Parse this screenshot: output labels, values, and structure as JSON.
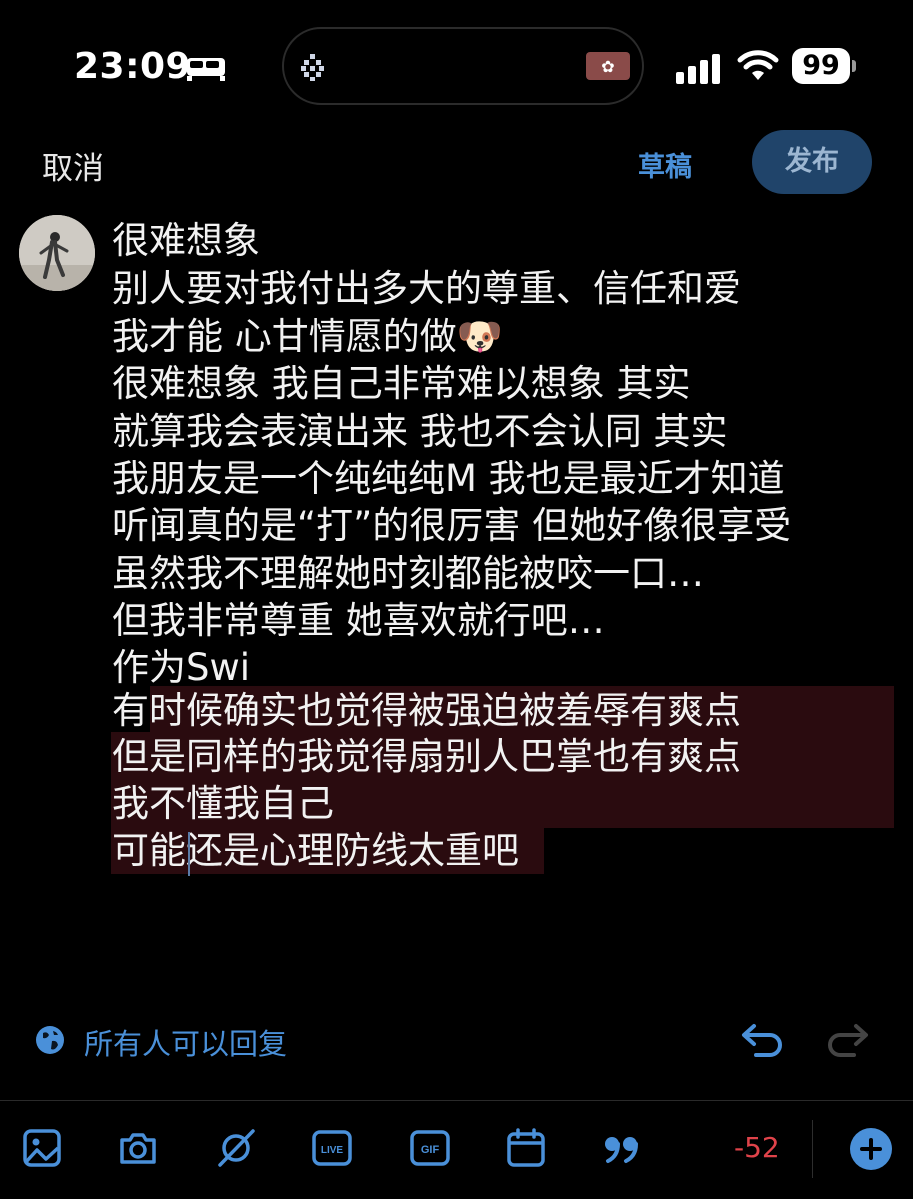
{
  "status_bar": {
    "time": "23:09",
    "battery": "99",
    "icons": [
      "bed-icon",
      "app-grid-icon",
      "flag-icon",
      "signal-icon",
      "wifi-icon",
      "battery-icon"
    ]
  },
  "nav": {
    "cancel": "取消",
    "drafts": "草稿",
    "publish": "发布"
  },
  "post": {
    "lines": [
      "很难想象",
      "别人要对我付出多大的尊重、信任和爱",
      "我才能 心甘情愿的做🐶",
      "很难想象 我自己非常难以想象 其实",
      "就算我会表演出来 我也不会认同 其实",
      "我朋友是一个纯纯纯M 我也是最近才知道",
      "听闻真的是“打”的很厉害 但她好像很享受",
      "虽然我不理解她时刻都能被咬一口…",
      "但我非常尊重 她喜欢就行吧…",
      "作为Swi",
      "有时候确实也觉得被强迫被羞辱有爽点",
      "但是同样的我觉得扇别人巴掌也有爽点",
      "我不懂我自己",
      "可能还是心理防线太重吧"
    ]
  },
  "reply_setting": {
    "label": "所有人可以回复"
  },
  "toolbar": {
    "icons": [
      "image-icon",
      "camera-icon",
      "no-location-icon",
      "live-icon",
      "gif-icon",
      "calendar-icon",
      "quote-icon",
      "add-icon"
    ],
    "live_label": "LIVE",
    "gif_label": "GIF",
    "char_count": "-52"
  },
  "colors": {
    "accent": "#4a90d9",
    "highlight": "#2a0b0f",
    "over_limit": "#e0434a",
    "publish_bg": "#20446a"
  }
}
